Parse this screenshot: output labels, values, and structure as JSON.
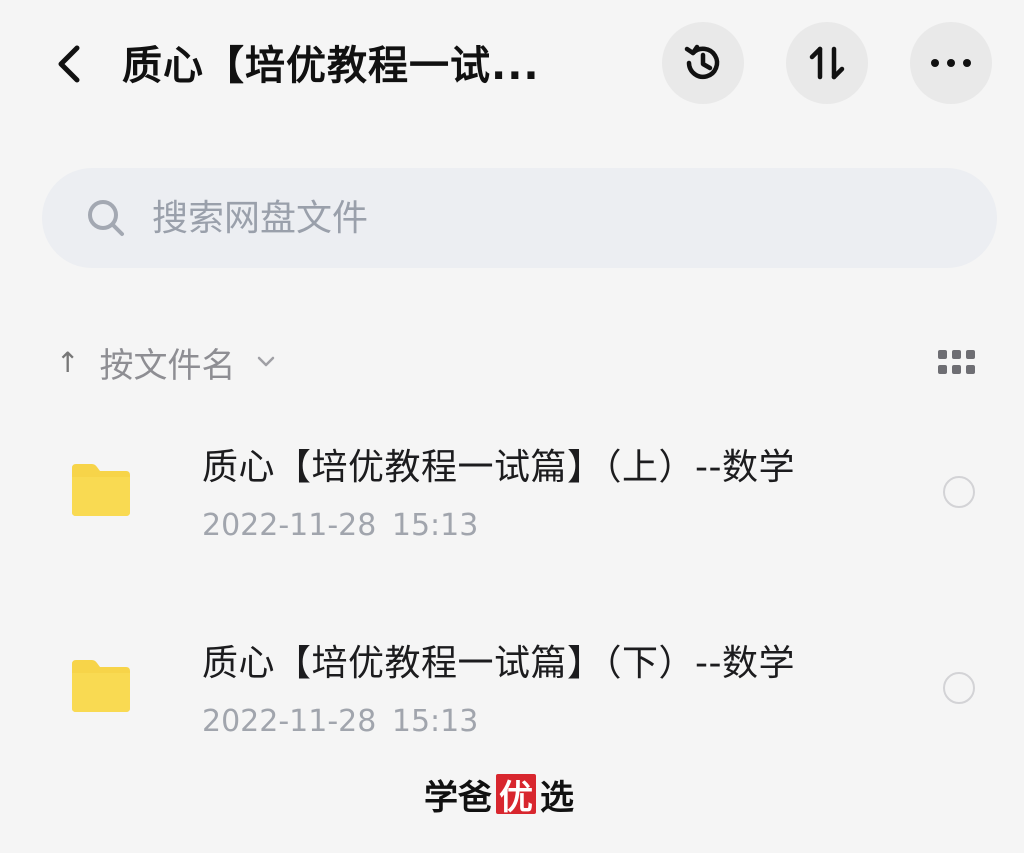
{
  "header": {
    "title": "质心【培优教程一试...",
    "back_icon": "chevron-left-icon",
    "history_icon": "history-icon",
    "sort_icon": "sort-arrows-icon",
    "more_icon": "more-dots-icon"
  },
  "search": {
    "placeholder": "搜索网盘文件",
    "icon": "search-icon"
  },
  "sort": {
    "label": "按文件名",
    "direction_glyph": "↑"
  },
  "files": [
    {
      "name": "质心【培优教程一试篇】（上）--数学",
      "date": "2022-11-28  15:13",
      "icon": "folder-icon"
    },
    {
      "name": "质心【培优教程一试篇】（下）--数学",
      "date": "2022-11-28  15:13",
      "icon": "folder-icon"
    }
  ],
  "watermark": {
    "part1": "学爸",
    "boxed": "优",
    "part2": "选"
  },
  "colors": {
    "background": "#f5f5f5",
    "folder": "#f7d449",
    "search_bg": "#eceef2",
    "button_bg": "#e9e9e9",
    "watermark_box": "#d8262e"
  }
}
